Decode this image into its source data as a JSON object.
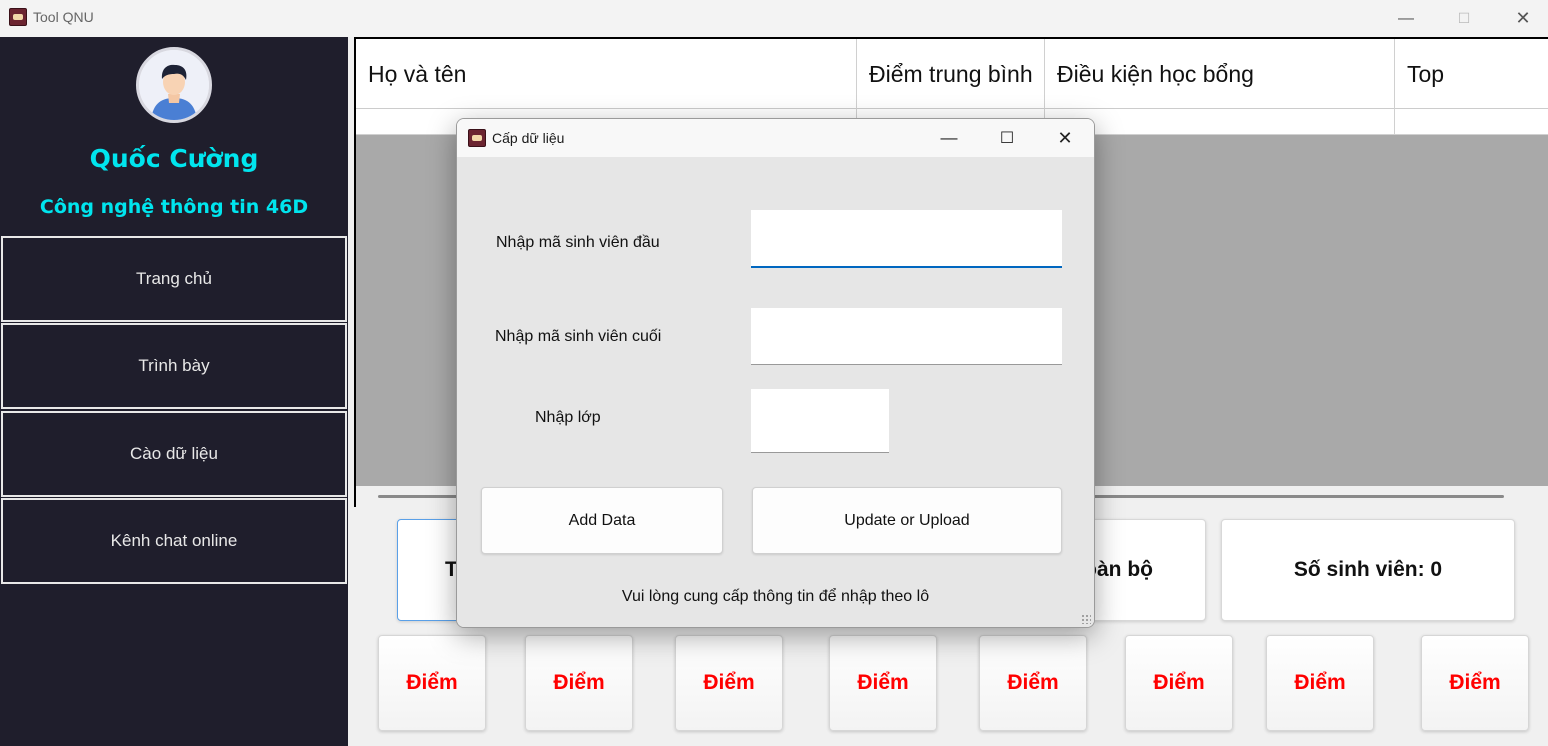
{
  "window": {
    "title": "Tool QNU",
    "minimize": "—",
    "maximize": "☐",
    "close": "✕"
  },
  "sidebar": {
    "user_name": "Quốc Cường",
    "user_class": "Công nghệ thông tin 46D",
    "items": [
      {
        "label": "Trang chủ"
      },
      {
        "label": "Trình bày"
      },
      {
        "label": "Cào dữ liệu"
      },
      {
        "label": "Kênh chat online"
      }
    ]
  },
  "grid": {
    "columns": [
      "Họ và tên",
      "Điểm trung bình",
      "Điều kiện học bổng",
      "Top"
    ]
  },
  "stats": {
    "left_card_partial": "T",
    "middle_card_partial": "oàn bộ",
    "student_count": "Số sinh viên: 0"
  },
  "score_buttons": [
    "Điểm",
    "Điểm",
    "Điểm",
    "Điểm",
    "Điểm",
    "Điểm",
    "Điểm",
    "Điểm"
  ],
  "dialog": {
    "title": "Cấp dữ liệu",
    "minimize": "—",
    "maximize": "☐",
    "close": "✕",
    "start_id_label": "Nhập mã sinh viên đầu",
    "start_id_value": "",
    "end_id_label": "Nhập mã sinh viên cuối",
    "end_id_value": "",
    "class_label": "Nhập lớp",
    "class_value": "",
    "add_button": "Add Data",
    "update_button": "Update or Upload",
    "note": "Vui lòng cung cấp thông tin để nhập theo lô"
  },
  "colors": {
    "sidebar_bg": "#1f1e2c",
    "accent_cyan": "#00e5ee",
    "score_red": "#ff0000",
    "focus_blue": "#0067c0"
  }
}
